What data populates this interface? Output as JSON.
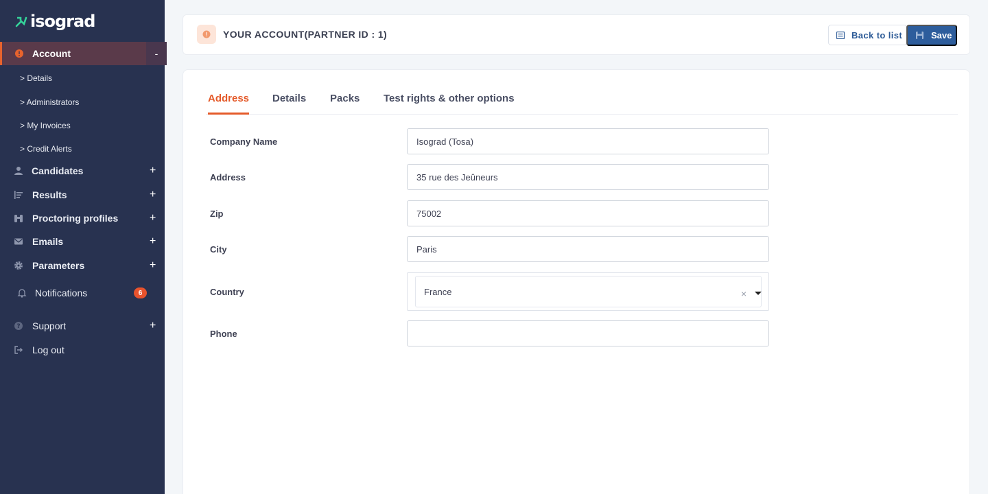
{
  "brand": {
    "name": "isograd"
  },
  "sidebar": {
    "account": {
      "label": "Account",
      "toggle": "-"
    },
    "sub_items": [
      "> Details",
      "> Administrators",
      "> My Invoices",
      "> Credit Alerts"
    ],
    "items": [
      {
        "label": "Candidates",
        "icon": "user-icon",
        "expand": "+"
      },
      {
        "label": "Results",
        "icon": "list-icon",
        "expand": "+"
      },
      {
        "label": "Proctoring profiles",
        "icon": "binoculars-icon",
        "expand": "+"
      },
      {
        "label": "Emails",
        "icon": "envelope-icon",
        "expand": "+"
      },
      {
        "label": "Parameters",
        "icon": "gear-icon",
        "expand": "+"
      }
    ],
    "notifications": {
      "label": "Notifications",
      "count": "6"
    },
    "support": {
      "label": "Support",
      "expand": "+"
    },
    "logout": {
      "label": "Log out"
    }
  },
  "header": {
    "title": "YOUR ACCOUNT(PARTNER ID : 1)",
    "back_label": "Back to list",
    "save_label": "Save"
  },
  "tabs": [
    {
      "label": "Address",
      "active": true
    },
    {
      "label": "Details",
      "active": false
    },
    {
      "label": "Packs",
      "active": false
    },
    {
      "label": "Test rights & other options",
      "active": false
    }
  ],
  "form": {
    "company_name": {
      "label": "Company Name",
      "value": "Isograd (Tosa)"
    },
    "address": {
      "label": "Address",
      "value": "35 rue des Jeûneurs"
    },
    "zip": {
      "label": "Zip",
      "value": "75002"
    },
    "city": {
      "label": "City",
      "value": "Paris"
    },
    "country": {
      "label": "Country",
      "value": "France",
      "clear": "×"
    },
    "phone": {
      "label": "Phone",
      "value": ""
    }
  },
  "colors": {
    "sidebar_bg": "#283250",
    "accent": "#e45a2a",
    "primary": "#2d5d9c"
  }
}
